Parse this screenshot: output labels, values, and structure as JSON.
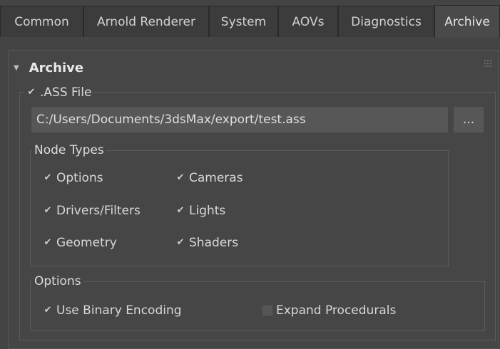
{
  "tabs": [
    {
      "label": "Common"
    },
    {
      "label": "Arnold Renderer"
    },
    {
      "label": "System"
    },
    {
      "label": "AOVs"
    },
    {
      "label": "Diagnostics"
    },
    {
      "label": "Archive",
      "active": true
    }
  ],
  "rollout": {
    "title": "Archive",
    "ass_file": {
      "label": ".ASS File",
      "checked": true,
      "path_value": "C:/Users/Documents/3dsMax/export/test.ass",
      "browse_label": "..."
    },
    "node_types": {
      "title": "Node Types",
      "items": [
        {
          "label": "Options",
          "checked": true
        },
        {
          "label": "Cameras",
          "checked": true
        },
        {
          "label": "Drivers/Filters",
          "checked": true
        },
        {
          "label": "Lights",
          "checked": true
        },
        {
          "label": "Geometry",
          "checked": true
        },
        {
          "label": "Shaders",
          "checked": true
        }
      ]
    },
    "options": {
      "title": "Options",
      "use_binary_encoding": {
        "label": "Use Binary Encoding",
        "checked": true
      },
      "expand_procedurals": {
        "label": "Expand Procedurals",
        "checked": false
      }
    }
  },
  "icons": {
    "collapse": "triangle-down",
    "check": "checkmark",
    "grip": "grip-dots"
  },
  "colors": {
    "background": "#444444",
    "panel": "#464646",
    "field": "#575757",
    "text": "#d8d8d8"
  }
}
